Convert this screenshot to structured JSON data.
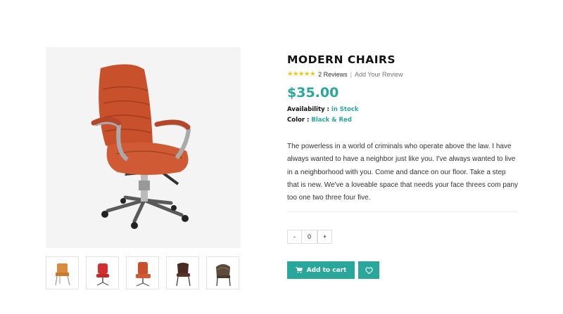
{
  "product": {
    "title": "MODERN CHAIRS",
    "reviews_count": "2 Reviews",
    "separator": "|",
    "add_review": "Add Your Review",
    "rating_stars": 5,
    "price": "$35.00",
    "availability_label": "Availability :",
    "availability_value": "in Stock",
    "color_label": "Color :",
    "color_value": "Black & Red",
    "description": "The powerless in a world of criminals who operate above the law. I have always wanted to have a neighbor just like you. I've always wanted to live in a neighborhood with you. Come and dance on our floor. Take a step that is new. We've a loveable space that needs your face threes com pany too one two three four five."
  },
  "quantity": {
    "minus": "-",
    "value": "0",
    "plus": "+"
  },
  "actions": {
    "add_to_cart": "Add to cart"
  },
  "icons": {
    "cart": "cart-icon",
    "wishlist": "heart-icon",
    "star": "star-icon"
  },
  "colors": {
    "accent": "#2aa79b",
    "star": "#f1c40f",
    "chair_leather": "#c8502b"
  }
}
